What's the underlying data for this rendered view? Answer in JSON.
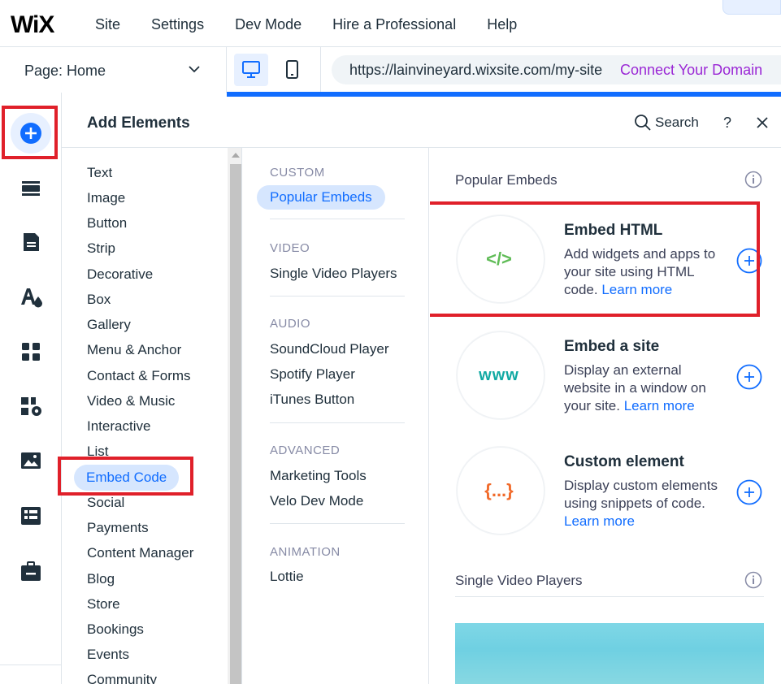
{
  "topbar": {
    "logo": "WiX",
    "menu": [
      "Site",
      "Settings",
      "Dev Mode",
      "Hire a Professional",
      "Help"
    ]
  },
  "bar2": {
    "page_label": "Page: Home",
    "url": "https://lainvineyard.wixsite.com/my-site",
    "connect_domain": "Connect Your Domain"
  },
  "panel": {
    "title": "Add Elements",
    "search_label": "Search",
    "help": "?",
    "categories": [
      "Text",
      "Image",
      "Button",
      "Strip",
      "Decorative",
      "Box",
      "Gallery",
      "Menu & Anchor",
      "Contact & Forms",
      "Video & Music",
      "Interactive",
      "List",
      "Embed Code",
      "Social",
      "Payments",
      "Content Manager",
      "Blog",
      "Store",
      "Bookings",
      "Events",
      "Community"
    ],
    "selected_category": "Embed Code",
    "subcategories": {
      "custom_header": "CUSTOM",
      "custom_items": [
        "Popular Embeds"
      ],
      "video_header": "VIDEO",
      "video_items": [
        "Single Video Players"
      ],
      "audio_header": "AUDIO",
      "audio_items": [
        "SoundCloud Player",
        "Spotify Player",
        "iTunes Button"
      ],
      "advanced_header": "ADVANCED",
      "advanced_items": [
        "Marketing Tools",
        "Velo Dev Mode"
      ],
      "animation_header": "ANIMATION",
      "animation_items": [
        "Lottie"
      ]
    },
    "content": {
      "section1_title": "Popular Embeds",
      "cards": [
        {
          "glyph": "</>",
          "title": "Embed HTML",
          "desc": "Add widgets and apps to your site using HTML code.",
          "learn_more": "Learn more",
          "glyph_color": "#60bc57"
        },
        {
          "glyph": "www",
          "title": "Embed a site",
          "desc": "Display an external website in a window on your site.",
          "learn_more": "Learn more",
          "glyph_color": "#11a9a3"
        },
        {
          "glyph": "{...}",
          "title": "Custom element",
          "desc": "Display custom elements using snippets of code.",
          "learn_more": "Learn more",
          "glyph_color": "#f16a2a"
        }
      ],
      "section2_title": "Single Video Players"
    }
  },
  "colors": {
    "accent": "#116dff",
    "highlight": "#e0202a",
    "connect": "#9a27d5"
  }
}
